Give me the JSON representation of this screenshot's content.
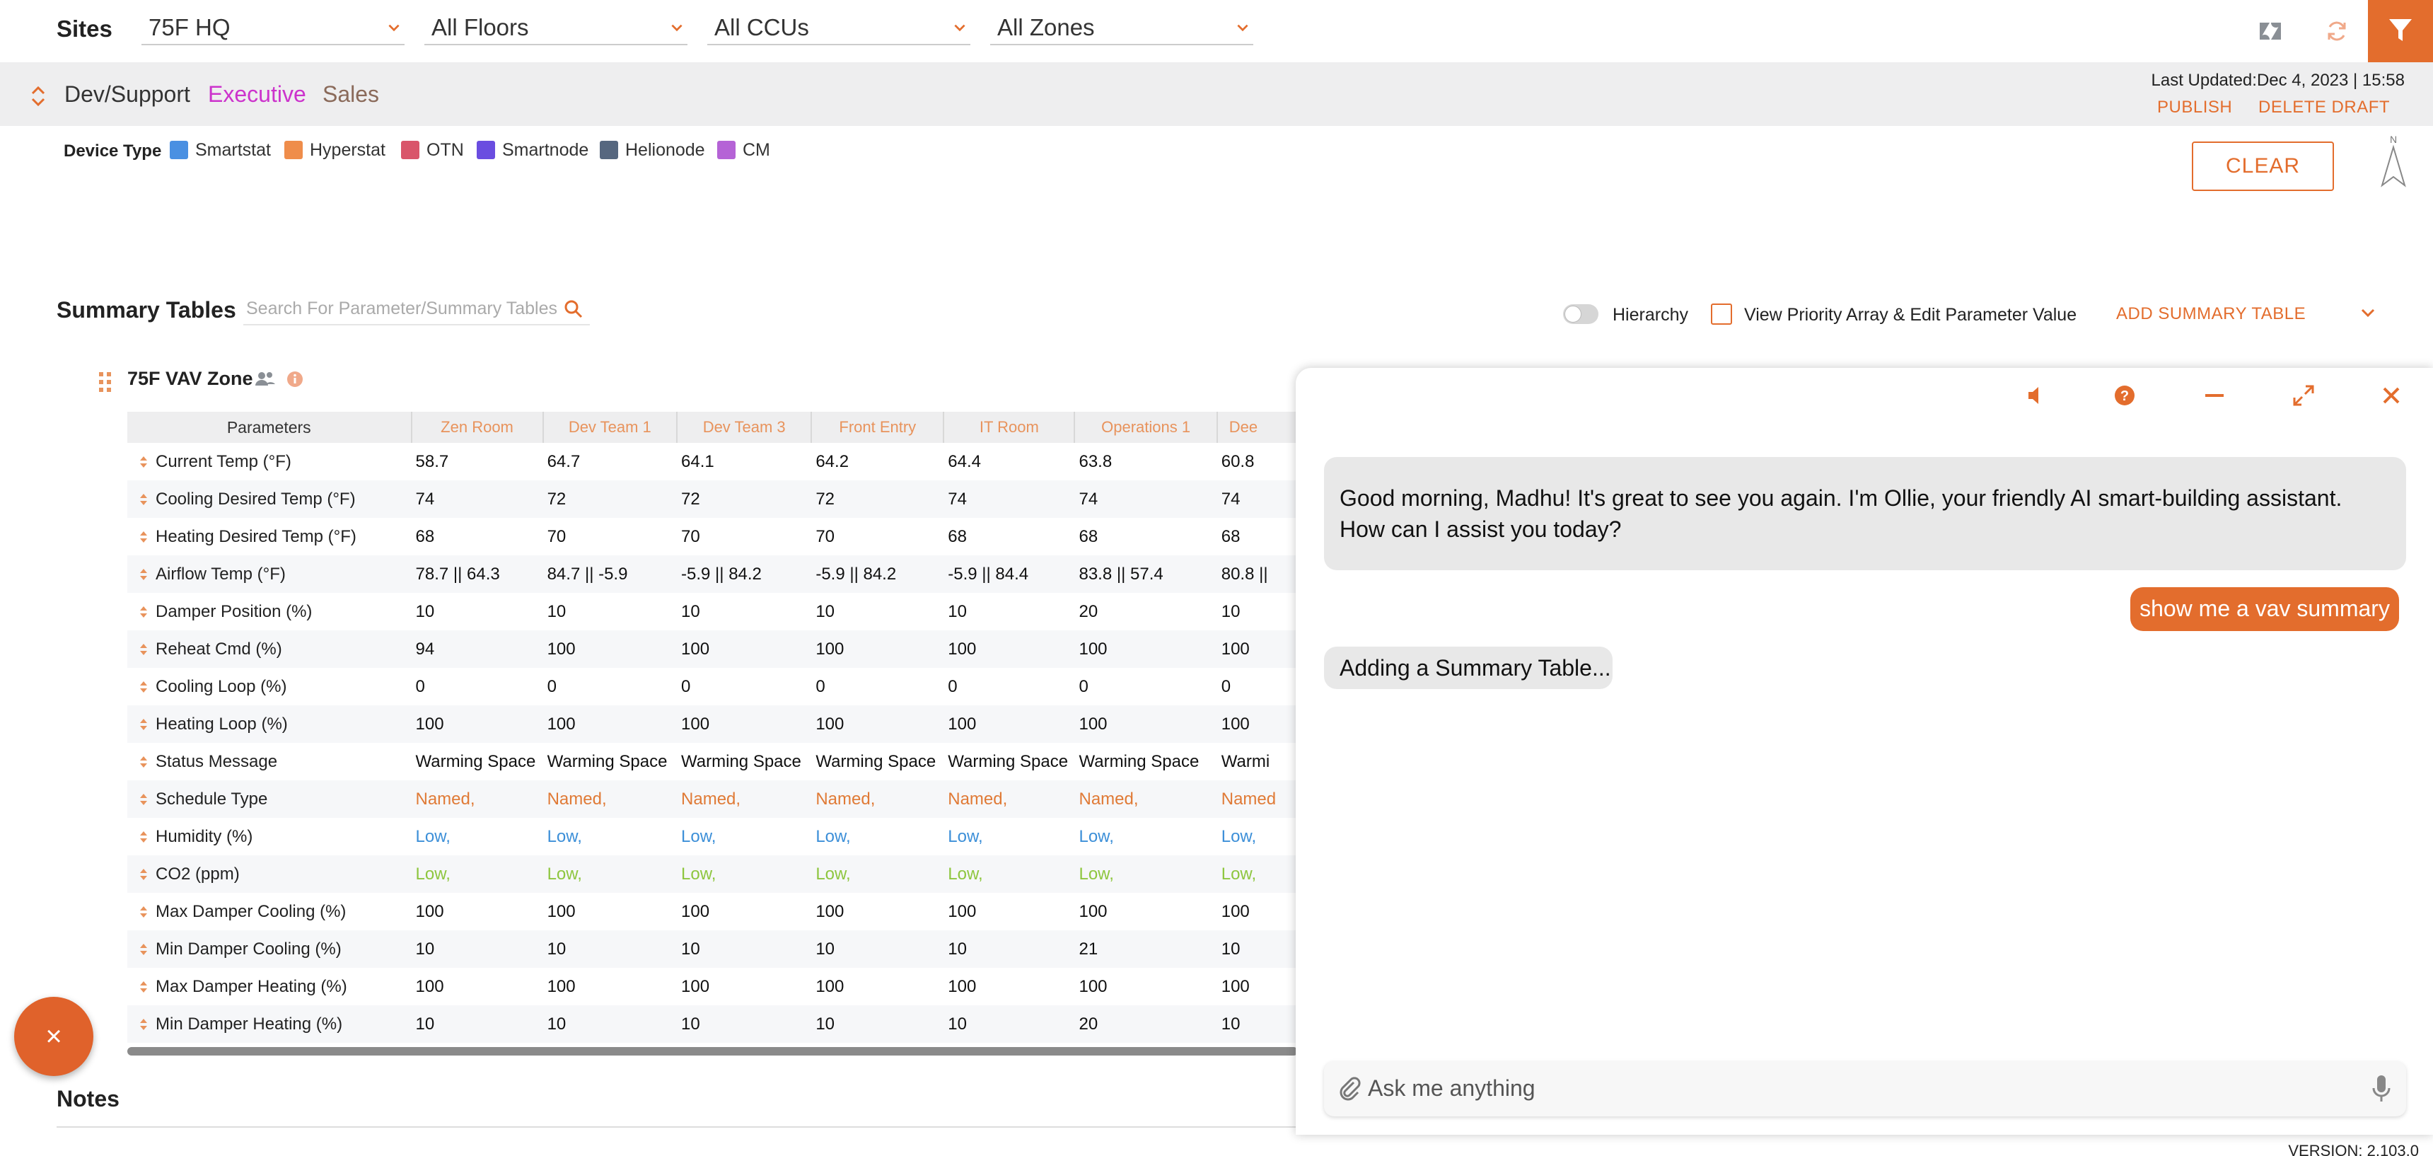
{
  "topbar": {
    "sites_label": "Sites",
    "site": "75F HQ",
    "floors": "All Floors",
    "ccus": "All CCUs",
    "zones": "All Zones",
    "icons": [
      "zendesk-icon",
      "refresh-icon",
      "filter-icon"
    ]
  },
  "subbar": {
    "tabs": [
      "Dev/Support",
      "Executive",
      "Sales"
    ],
    "active_tab": "Executive",
    "last_updated_label": "Last Updated:",
    "last_updated_value": "Dec 4, 2023 | 15:58",
    "publish": "PUBLISH",
    "delete_draft": "DELETE DRAFT"
  },
  "device_type": {
    "label": "Device Type",
    "items": [
      {
        "name": "Smartstat",
        "color": "#4a90e2"
      },
      {
        "name": "Hyperstat",
        "color": "#ef8d4b"
      },
      {
        "name": "OTN",
        "color": "#d9556a"
      },
      {
        "name": "Smartnode",
        "color": "#6a4de0"
      },
      {
        "name": "Helionode",
        "color": "#56677f"
      },
      {
        "name": "CM",
        "color": "#b563d6"
      }
    ],
    "clear": "CLEAR",
    "north": "N"
  },
  "summary": {
    "title": "Summary Tables",
    "search_placeholder": "Search For Parameter/Summary Tables",
    "hierarchy": "Hierarchy",
    "priority": "View Priority Array & Edit Parameter Value",
    "add": "ADD SUMMARY TABLE"
  },
  "table": {
    "zone_title": "75F VAV Zone",
    "param_header": "Parameters",
    "columns": [
      "Zen Room",
      "Dev Team 1",
      "Dev Team 3",
      "Front Entry",
      "IT Room",
      "Operations 1",
      "Dee"
    ],
    "rows": [
      {
        "param": "Current Temp  (°F)",
        "values": [
          "58.7",
          "64.7",
          "64.1",
          "64.2",
          "64.4",
          "63.8",
          "60.8"
        ],
        "style": ""
      },
      {
        "param": "Cooling Desired Temp  (°F)",
        "values": [
          "74",
          "72",
          "72",
          "72",
          "74",
          "74",
          "74"
        ],
        "style": ""
      },
      {
        "param": "Heating Desired Temp  (°F)",
        "values": [
          "68",
          "70",
          "70",
          "70",
          "68",
          "68",
          "68"
        ],
        "style": ""
      },
      {
        "param": "Airflow Temp  (°F)",
        "values": [
          "78.7 || 64.3",
          "84.7 || -5.9",
          "-5.9 || 84.2",
          "-5.9 || 84.2",
          "-5.9 || 84.4",
          "83.8 || 57.4",
          "80.8 ||"
        ],
        "style": ""
      },
      {
        "param": "Damper Position  (%)",
        "values": [
          "10",
          "10",
          "10",
          "10",
          "10",
          "20",
          "10"
        ],
        "style": ""
      },
      {
        "param": "Reheat Cmd  (%)",
        "values": [
          "94",
          "100",
          "100",
          "100",
          "100",
          "100",
          "100"
        ],
        "style": ""
      },
      {
        "param": "Cooling Loop  (%)",
        "values": [
          "0",
          "0",
          "0",
          "0",
          "0",
          "0",
          "0"
        ],
        "style": ""
      },
      {
        "param": "Heating Loop  (%)",
        "values": [
          "100",
          "100",
          "100",
          "100",
          "100",
          "100",
          "100"
        ],
        "style": ""
      },
      {
        "param": "Status Message",
        "values": [
          "Warming Space",
          "Warming Space",
          "Warming Space",
          "Warming Space",
          "Warming Space",
          "Warming Space",
          "Warmi"
        ],
        "style": ""
      },
      {
        "param": "Schedule Type",
        "values": [
          "Named,",
          "Named,",
          "Named,",
          "Named,",
          "Named,",
          "Named,",
          "Named"
        ],
        "style": "c-orange"
      },
      {
        "param": "Humidity  (%)",
        "values": [
          "Low,",
          "Low,",
          "Low,",
          "Low,",
          "Low,",
          "Low,",
          "Low,"
        ],
        "style": "c-blue"
      },
      {
        "param": "CO2  (ppm)",
        "values": [
          "Low,",
          "Low,",
          "Low,",
          "Low,",
          "Low,",
          "Low,",
          "Low,"
        ],
        "style": "c-green"
      },
      {
        "param": "Max Damper Cooling  (%)",
        "values": [
          "100",
          "100",
          "100",
          "100",
          "100",
          "100",
          "100"
        ],
        "style": ""
      },
      {
        "param": "Min Damper Cooling  (%)",
        "values": [
          "10",
          "10",
          "10",
          "10",
          "10",
          "21",
          "10"
        ],
        "style": ""
      },
      {
        "param": "Max Damper Heating  (%)",
        "values": [
          "100",
          "100",
          "100",
          "100",
          "100",
          "100",
          "100"
        ],
        "style": ""
      },
      {
        "param": "Min Damper Heating  (%)",
        "values": [
          "10",
          "10",
          "10",
          "10",
          "10",
          "20",
          "10"
        ],
        "style": ""
      }
    ]
  },
  "notes": {
    "title": "Notes"
  },
  "version": "VERSION: 2.103.0",
  "fab": {
    "label": "×"
  },
  "chat": {
    "messages": [
      {
        "role": "bot",
        "text": "Good morning, Madhu! It's great to see you again. I'm Ollie, your friendly AI smart-building assistant. How can I assist you today?"
      },
      {
        "role": "user",
        "text": "show me a vav summary"
      },
      {
        "role": "bot",
        "text": "Adding a Summary Table..."
      }
    ],
    "input_placeholder": "Ask me anything",
    "header_icons": [
      "mute-icon",
      "help-icon",
      "minimize-icon",
      "expand-icon",
      "close-icon"
    ]
  },
  "colors": {
    "accent": "#e36d2d",
    "active_tab": "#cc33cc",
    "sales_tab": "#8a6a5a"
  }
}
